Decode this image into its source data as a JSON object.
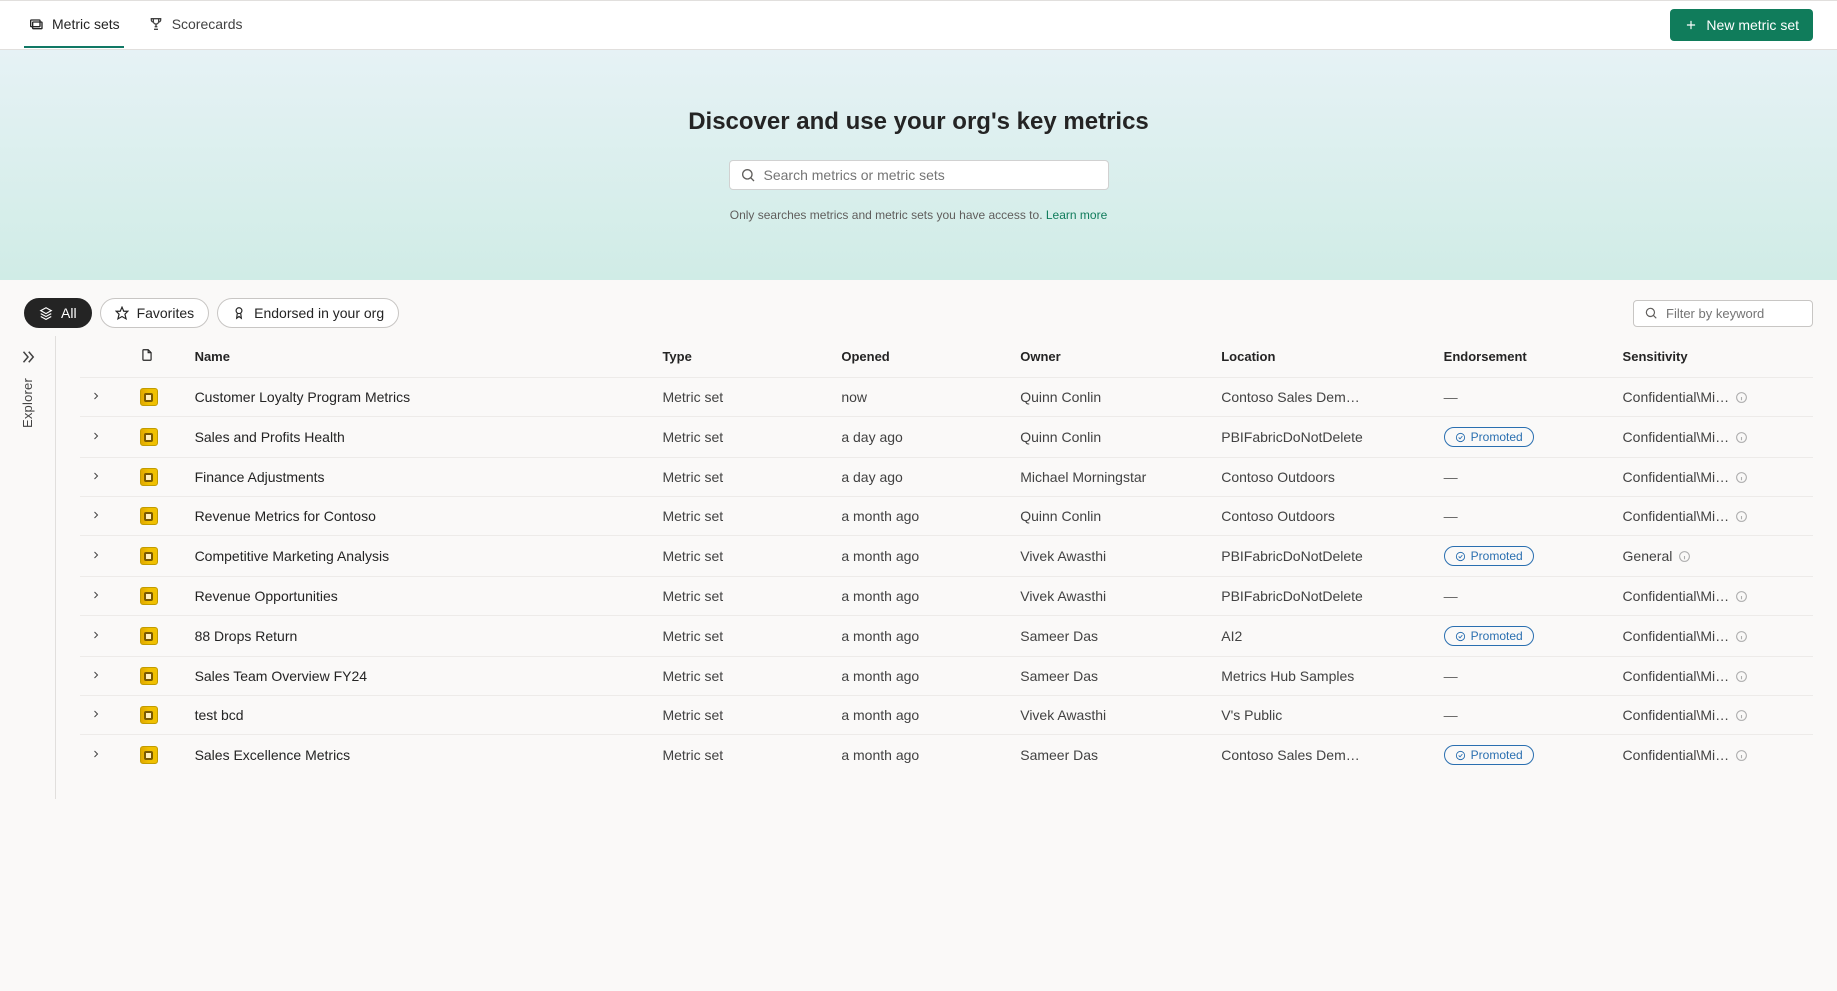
{
  "tabs": {
    "metric_sets": "Metric sets",
    "scorecards": "Scorecards"
  },
  "actions": {
    "new_metric_set": "New metric set"
  },
  "hero": {
    "title": "Discover and use your org's key metrics",
    "search_placeholder": "Search metrics or metric sets",
    "note": "Only searches metrics and metric sets you have access to.",
    "learn_more": "Learn more"
  },
  "chips": {
    "all": "All",
    "favorites": "Favorites",
    "endorsed": "Endorsed in your org"
  },
  "filter": {
    "placeholder": "Filter by keyword"
  },
  "explorer": {
    "label": "Explorer"
  },
  "columns": {
    "name": "Name",
    "type": "Type",
    "opened": "Opened",
    "owner": "Owner",
    "location": "Location",
    "endorsement": "Endorsement",
    "sensitivity": "Sensitivity"
  },
  "endorsement_label": "Promoted",
  "rows": [
    {
      "name": "Customer Loyalty Program Metrics",
      "type": "Metric set",
      "opened": "now",
      "owner": "Quinn Conlin",
      "location": "Contoso Sales Dem…",
      "endorsement": null,
      "sensitivity": "Confidential\\Mi…",
      "sens_info": true
    },
    {
      "name": "Sales and Profits Health",
      "type": "Metric set",
      "opened": "a day ago",
      "owner": "Quinn Conlin",
      "location": "PBIFabricDoNotDelete",
      "endorsement": "Promoted",
      "sensitivity": "Confidential\\Mi…",
      "sens_info": true
    },
    {
      "name": "Finance Adjustments",
      "type": "Metric set",
      "opened": "a day ago",
      "owner": "Michael Morningstar",
      "location": "Contoso Outdoors",
      "endorsement": null,
      "sensitivity": "Confidential\\Mi…",
      "sens_info": true
    },
    {
      "name": "Revenue Metrics for Contoso",
      "type": "Metric set",
      "opened": "a month ago",
      "owner": "Quinn Conlin",
      "location": "Contoso Outdoors",
      "endorsement": null,
      "sensitivity": "Confidential\\Mi…",
      "sens_info": true
    },
    {
      "name": "Competitive Marketing Analysis",
      "type": "Metric set",
      "opened": "a month ago",
      "owner": "Vivek Awasthi",
      "location": "PBIFabricDoNotDelete",
      "endorsement": "Promoted",
      "sensitivity": "General",
      "sens_info": true
    },
    {
      "name": "Revenue Opportunities",
      "type": "Metric set",
      "opened": "a month ago",
      "owner": "Vivek Awasthi",
      "location": "PBIFabricDoNotDelete",
      "endorsement": null,
      "sensitivity": "Confidential\\Mi…",
      "sens_info": true
    },
    {
      "name": "88 Drops Return",
      "type": "Metric set",
      "opened": "a month ago",
      "owner": "Sameer Das",
      "location": "AI2",
      "endorsement": "Promoted",
      "sensitivity": "Confidential\\Mi…",
      "sens_info": true
    },
    {
      "name": "Sales Team Overview FY24",
      "type": "Metric set",
      "opened": "a month ago",
      "owner": "Sameer Das",
      "location": "Metrics Hub Samples",
      "endorsement": null,
      "sensitivity": "Confidential\\Mi…",
      "sens_info": true
    },
    {
      "name": "test bcd",
      "type": "Metric set",
      "opened": "a month ago",
      "owner": "Vivek Awasthi",
      "location": "V's Public",
      "endorsement": null,
      "sensitivity": "Confidential\\Mi…",
      "sens_info": true
    },
    {
      "name": "Sales Excellence Metrics",
      "type": "Metric set",
      "opened": "a month ago",
      "owner": "Sameer Das",
      "location": "Contoso Sales Dem…",
      "endorsement": "Promoted",
      "sensitivity": "Confidential\\Mi…",
      "sens_info": true
    }
  ]
}
